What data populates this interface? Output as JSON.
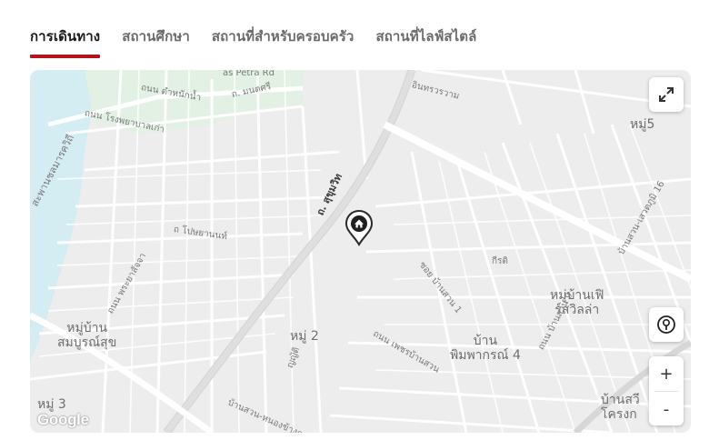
{
  "tabs": [
    {
      "label": "การเดินทาง",
      "active": true
    },
    {
      "label": "สถานศึกษา",
      "active": false
    },
    {
      "label": "สถานที่สำหรับครอบครัว",
      "active": false
    },
    {
      "label": "สถานที่ไลฟ์สไตล์",
      "active": false
    }
  ],
  "map": {
    "labels": {
      "petra": "as Petra Rd",
      "inthrawarom": "อินทรวรวาม",
      "tamnak": "ถนน ตำหนักน้ำ",
      "montsri": "ถ. มนตศรี",
      "rongphayaban": "ถนน โรงพยาบาลเก่า",
      "moo5": "หมู่5",
      "sapan": "สะพานชลมารควิถี",
      "sukhumvit": "ถ. สุขุมวิท",
      "sawaengsuk": "บ้านสวน-เสวตภูมิ 16",
      "phoyanon": "ถ โปษยานนท์",
      "soi_baansuan": "ซอย บ้านสวน 1",
      "krit": "กีรติ",
      "phrabanchong": "ถนน พระยาสัจจา",
      "moo_baan_fe": "หมู่บ้านเฟิ\nร์สวิลล่า",
      "moo_baan_sombun": "หมู่บ้าน\nสมบูรณ์สุข",
      "moo2": "หมู่ 2",
      "phetbaansuan": "ถนน เพชรบ้านสวน",
      "baan_phim": "บ้าน\nพิมพากรณ์ 4",
      "baansuan9": "ถนน บ้านสวน 9",
      "pak": "ญญัติ",
      "moo3": "หมู่ 3",
      "nongkhang": "บ้านสวน-หนองข้างค",
      "baan_rong": "บ้านสวี\nโครงก"
    },
    "attribution": "Google",
    "controls": {
      "zoom_in": "+",
      "zoom_out": "-"
    }
  },
  "icons": [
    "fullscreen-icon",
    "pegman-icon",
    "home-pin-icon"
  ]
}
